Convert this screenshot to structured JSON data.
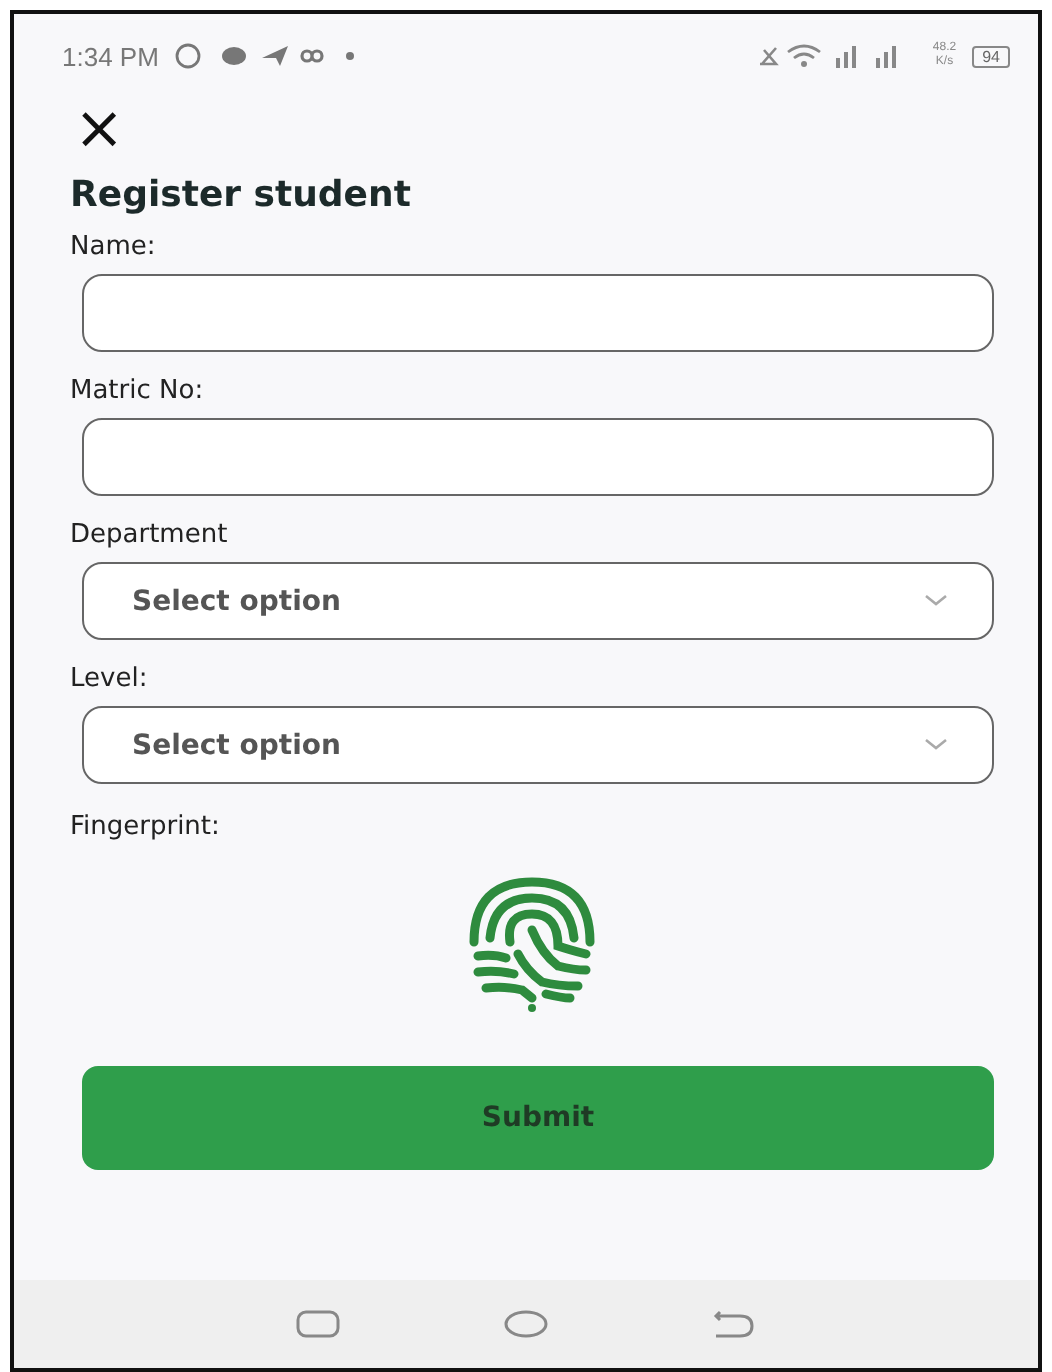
{
  "status_bar": {
    "time": "1:34 PM",
    "network_speed": "48.2",
    "speed_unit": "K/s",
    "battery": "94"
  },
  "header": {
    "close": "×",
    "title": "Register student"
  },
  "fields": [
    {
      "kind": "text",
      "label": "Name:"
    },
    {
      "kind": "text",
      "label": "Matric No:"
    },
    {
      "kind": "select",
      "label": "Department",
      "placeholder": "Select option"
    },
    {
      "kind": "select",
      "label": "Level:",
      "placeholder": "Select option"
    }
  ],
  "fingerprint": {
    "label": "Fingerprint:"
  },
  "submit": {
    "label": "Submit"
  }
}
